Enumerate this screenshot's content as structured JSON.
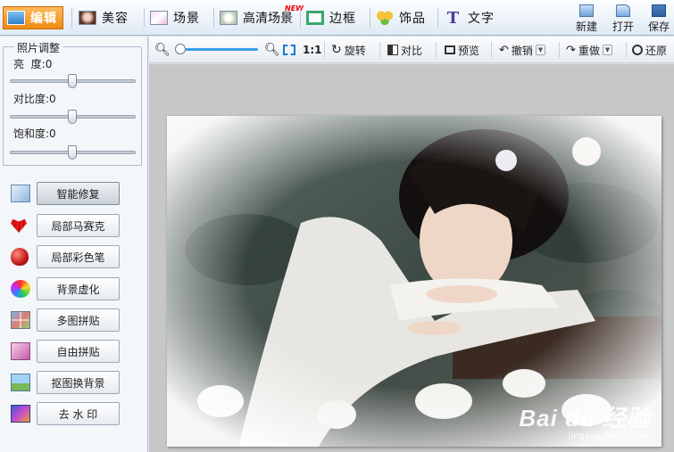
{
  "main_tabs": [
    {
      "label": "编辑",
      "icon": "photo-edit-icon"
    },
    {
      "label": "美容",
      "icon": "face-beauty-icon"
    },
    {
      "label": "场景",
      "icon": "scene-frame-icon"
    },
    {
      "label": "高清场景",
      "icon": "hd-scene-icon",
      "badge": "NEW"
    },
    {
      "label": "边框",
      "icon": "border-frame-icon"
    },
    {
      "label": "饰品",
      "icon": "clover-icon"
    },
    {
      "label": "文字",
      "icon": "text-t-icon"
    }
  ],
  "file_actions": {
    "new": "新建",
    "open": "打开",
    "save": "保存"
  },
  "adjust": {
    "title": "照片调整",
    "brightness": {
      "label": "亮  度:",
      "value": "0",
      "level": 0.5
    },
    "contrast": {
      "label": "对比度:",
      "value": "0",
      "level": 0.5
    },
    "saturation": {
      "label": "饱和度:",
      "value": "0",
      "level": 0.5
    }
  },
  "tools": [
    {
      "label": "智能修复",
      "icon": "magic-wand-icon"
    },
    {
      "label": "局部马赛克",
      "icon": "mosaic-heart-icon"
    },
    {
      "label": "局部彩色笔",
      "icon": "color-apple-icon"
    },
    {
      "label": "背景虚化",
      "icon": "color-dots-icon"
    },
    {
      "label": "多图拼贴",
      "icon": "grid-collage-icon"
    },
    {
      "label": "自由拼贴",
      "icon": "free-collage-icon"
    },
    {
      "label": "抠图换背景",
      "icon": "cutout-bg-icon"
    },
    {
      "label": "去 水 印",
      "icon": "remove-watermark-icon"
    }
  ],
  "toolbar": {
    "ratio": "1:1",
    "rotate": "旋转",
    "compare": "对比",
    "preview": "预览",
    "undo": "撤销",
    "redo": "重做",
    "restore": "还原",
    "zoom_level": 0.05
  },
  "watermark": {
    "main": "Bai du 经验",
    "sub": "jingyan.baidu.com"
  },
  "colors": {
    "accent": "#f08a12",
    "slider": "#3aa0ea"
  }
}
